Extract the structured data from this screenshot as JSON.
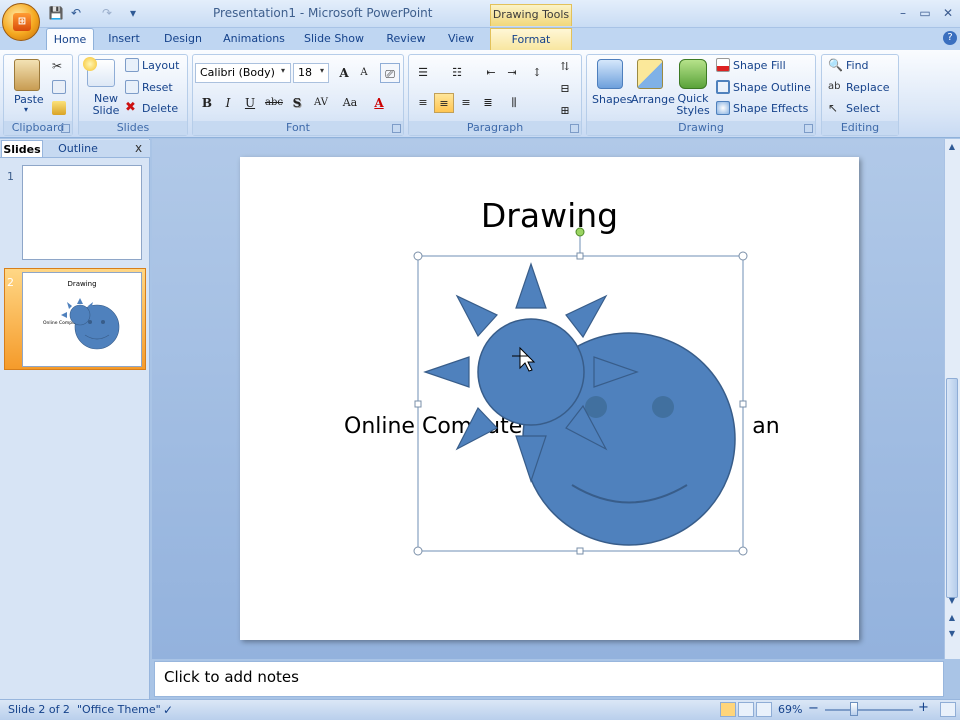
{
  "window": {
    "title": "Presentation1 - Microsoft PowerPoint",
    "contextual_tab_group": "Drawing Tools",
    "office_button_label": "Office"
  },
  "quick_access": {
    "save": "💾",
    "undo": "↶",
    "redo": "↷",
    "customize": "▾"
  },
  "window_controls": {
    "minimize": "–",
    "restore": "▭",
    "close": "✕"
  },
  "tabs": [
    "Home",
    "Insert",
    "Design",
    "Animations",
    "Slide Show",
    "Review",
    "View",
    "Format"
  ],
  "active_tab": "Home",
  "ribbon": {
    "clipboard": {
      "label": "Clipboard",
      "paste": "Paste"
    },
    "slides": {
      "label": "Slides",
      "new_slide": "New Slide",
      "layout": "Layout",
      "reset": "Reset",
      "delete": "Delete"
    },
    "font": {
      "label": "Font",
      "font_name": "Calibri (Body)",
      "font_size": "18",
      "bold": "B",
      "italic": "I",
      "underline": "U",
      "strike": "abc",
      "shadow": "S",
      "spacing": "AV",
      "case": "Aa",
      "color": "A",
      "grow": "A",
      "shrink": "A"
    },
    "paragraph": {
      "label": "Paragraph"
    },
    "drawing": {
      "label": "Drawing",
      "shapes": "Shapes",
      "arrange": "Arrange",
      "quick_styles": "Quick Styles",
      "shape_fill": "Shape Fill",
      "shape_outline": "Shape Outline",
      "shape_effects": "Shape Effects"
    },
    "editing": {
      "label": "Editing",
      "find": "Find",
      "replace": "Replace",
      "select": "Select"
    }
  },
  "left_pane": {
    "tabs": [
      "Slides",
      "Outline"
    ],
    "close": "x",
    "slides": [
      {
        "number": "1",
        "title": "",
        "body": ""
      },
      {
        "number": "2",
        "title": "Drawing",
        "body": "Online Computer ... an"
      }
    ]
  },
  "slide": {
    "title": "Drawing",
    "body_text": "Online Compute",
    "body_tail": "an"
  },
  "notes": {
    "placeholder": "Click to add notes"
  },
  "status": {
    "slide_of": "Slide 2 of 2",
    "theme": "\"Office Theme\"",
    "zoom": "69%",
    "zoom_minus": "−",
    "zoom_plus": "+"
  },
  "colors": {
    "shape_fill": "#4f81bd",
    "shape_stroke": "#385d8a",
    "ribbon_bg": "#dbe7f7",
    "accent_text": "#15428b",
    "selected_thumb": "#f59b2b"
  }
}
